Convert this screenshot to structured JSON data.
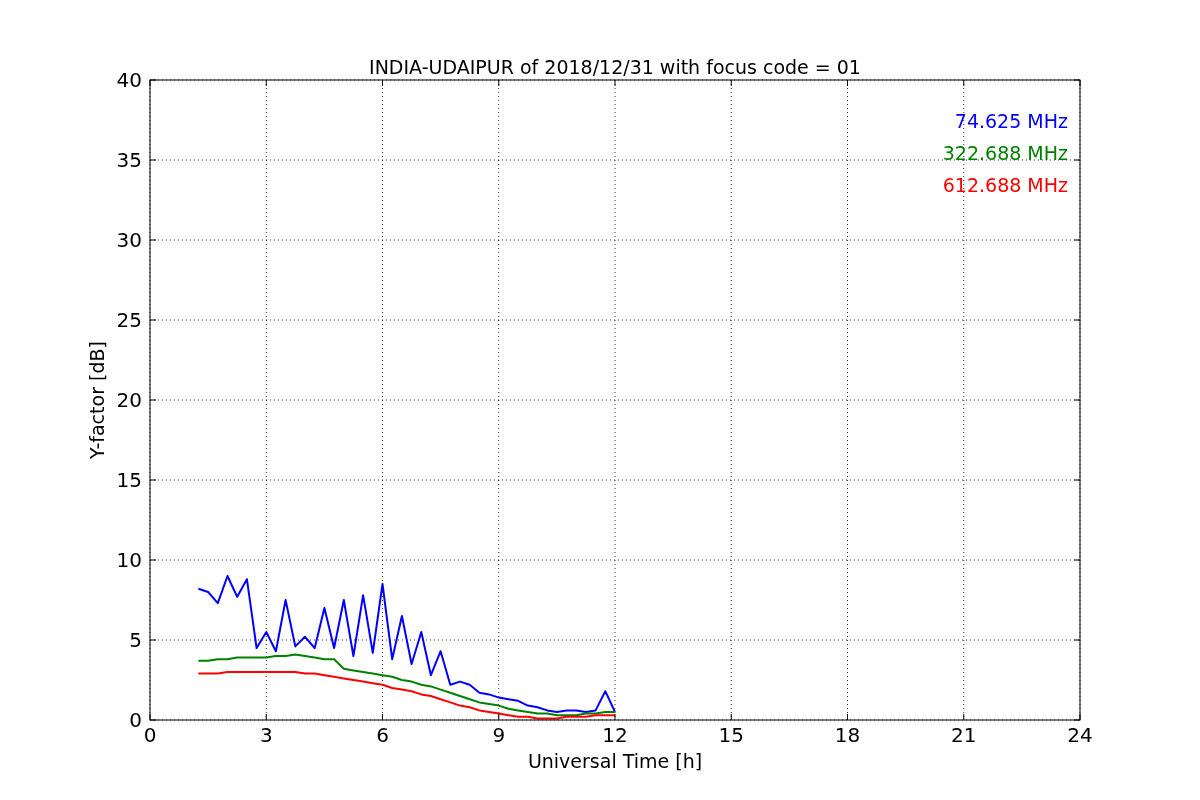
{
  "chart_data": {
    "type": "line",
    "title": "INDIA-UDAIPUR of 2018/12/31 with focus code = 01",
    "xlabel": "Universal Time [h]",
    "ylabel": "Y-factor [dB]",
    "x": [
      1.25,
      1.5,
      1.75,
      2,
      2.25,
      2.5,
      2.75,
      3,
      3.25,
      3.5,
      3.75,
      4,
      4.25,
      4.5,
      4.75,
      5,
      5.25,
      5.5,
      5.75,
      6,
      6.25,
      6.5,
      6.75,
      7,
      7.25,
      7.5,
      7.75,
      8,
      8.25,
      8.5,
      8.75,
      9,
      9.25,
      9.5,
      9.75,
      10,
      10.25,
      10.5,
      10.75,
      11,
      11.25,
      11.5,
      11.75,
      12
    ],
    "series": [
      {
        "name": "74.625 MHz",
        "color": "#0000ff",
        "values": [
          8.2,
          8.0,
          7.3,
          9.0,
          7.7,
          8.8,
          4.5,
          5.5,
          4.3,
          7.5,
          4.6,
          5.2,
          4.5,
          7.0,
          4.5,
          7.5,
          4.0,
          7.8,
          4.2,
          8.5,
          3.8,
          6.5,
          3.5,
          5.5,
          2.8,
          4.3,
          2.2,
          2.4,
          2.2,
          1.7,
          1.6,
          1.4,
          1.3,
          1.2,
          0.9,
          0.8,
          0.6,
          0.5,
          0.6,
          0.6,
          0.5,
          0.6,
          1.8,
          0.5
        ]
      },
      {
        "name": "322.688 MHz",
        "color": "#008000",
        "values": [
          3.7,
          3.7,
          3.8,
          3.8,
          3.9,
          3.9,
          3.9,
          3.9,
          4.0,
          4.0,
          4.1,
          4.0,
          3.9,
          3.8,
          3.8,
          3.2,
          3.1,
          3.0,
          2.9,
          2.8,
          2.7,
          2.5,
          2.4,
          2.2,
          2.1,
          1.9,
          1.7,
          1.5,
          1.3,
          1.1,
          1.0,
          0.9,
          0.7,
          0.6,
          0.5,
          0.4,
          0.4,
          0.3,
          0.3,
          0.3,
          0.4,
          0.4,
          0.5,
          0.5
        ]
      },
      {
        "name": "612.688 MHz",
        "color": "#ff0000",
        "values": [
          2.9,
          2.9,
          2.9,
          3.0,
          3.0,
          3.0,
          3.0,
          3.0,
          3.0,
          3.0,
          3.0,
          2.9,
          2.9,
          2.8,
          2.7,
          2.6,
          2.5,
          2.4,
          2.3,
          2.2,
          2.0,
          1.9,
          1.8,
          1.6,
          1.5,
          1.3,
          1.1,
          0.9,
          0.8,
          0.6,
          0.5,
          0.4,
          0.3,
          0.2,
          0.2,
          0.1,
          0.1,
          0.1,
          0.2,
          0.2,
          0.2,
          0.3,
          0.3,
          0.3
        ]
      }
    ],
    "grid": true,
    "xlim": [
      0,
      24
    ],
    "ylim": [
      0,
      40
    ],
    "xticks": [
      0,
      3,
      6,
      9,
      12,
      15,
      18,
      21,
      24
    ],
    "yticks": [
      0,
      5,
      10,
      15,
      20,
      25,
      30,
      35,
      40
    ]
  }
}
